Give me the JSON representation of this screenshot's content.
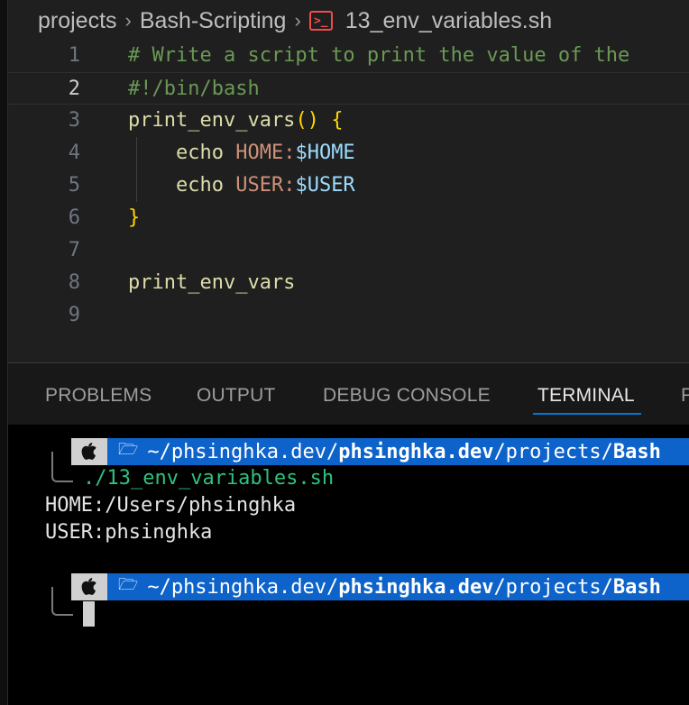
{
  "breadcrumb": {
    "root": "projects",
    "folder": "Bash-Scripting",
    "file": "13_env_variables.sh",
    "file_icon": "terminal-icon"
  },
  "editor": {
    "lines": [
      {
        "n": "1",
        "comment": "# Write a script to print the value of the"
      },
      {
        "n": "2",
        "comment": "#!/bin/bash"
      },
      {
        "n": "3",
        "func": "print_env_vars",
        "parens": "()",
        "brace": "{"
      },
      {
        "n": "4",
        "cmd": "echo",
        "str": "HOME:",
        "var": "$HOME"
      },
      {
        "n": "5",
        "cmd": "echo",
        "str": "USER:",
        "var": "$USER"
      },
      {
        "n": "6",
        "brace": "}"
      },
      {
        "n": "7"
      },
      {
        "n": "8",
        "func": "print_env_vars"
      },
      {
        "n": "9"
      }
    ],
    "current_line": "2"
  },
  "panel": {
    "tabs": [
      "PROBLEMS",
      "OUTPUT",
      "DEBUG CONSOLE",
      "TERMINAL",
      "P"
    ],
    "active_tab": "TERMINAL"
  },
  "terminal": {
    "prompt1": {
      "path_prefix": "~/phsinghka.dev/",
      "path_bold": "phsinghka.dev",
      "path_suffix": "/projects/",
      "path_end": "Bash"
    },
    "command": "./13_env_variables.sh",
    "output": [
      "HOME:/Users/phsinghka",
      "USER:phsinghka"
    ],
    "prompt2": {
      "path_prefix": "~/phsinghka.dev/",
      "path_bold": "phsinghka.dev",
      "path_suffix": "/projects/",
      "path_end": "Bash"
    }
  },
  "colors": {
    "accent": "#0078d4",
    "prompt_path_bg": "#0d63c9",
    "command_green": "#2ec27e",
    "comment_green": "#6a9955"
  }
}
